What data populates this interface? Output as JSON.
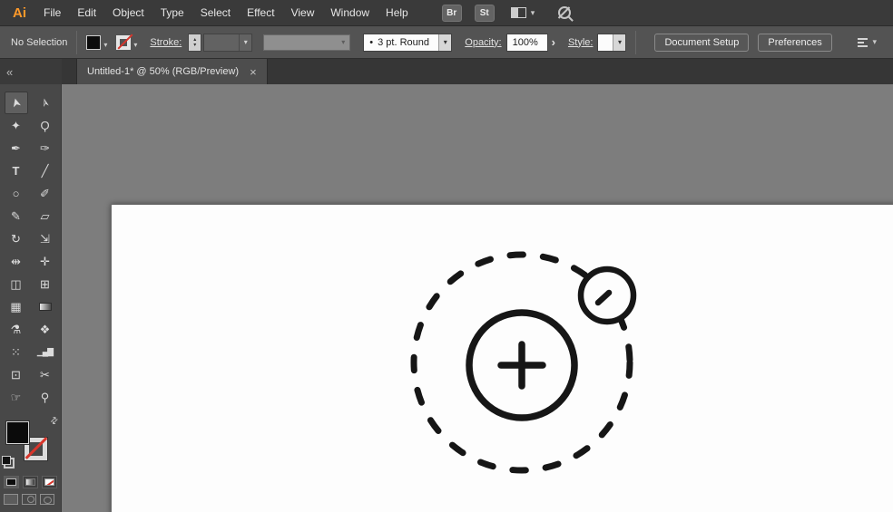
{
  "colors": {
    "accent_orange": "#ff9a2a",
    "slash_red": "#d8352b",
    "ink": "#161616",
    "canvas_bg": "#7d7d7d",
    "artboard_bg": "#fdfdfd",
    "menubar_bg": "#3a3a3a",
    "controlbar_bg": "#535353",
    "toolbar_bg": "#484848",
    "tabstrip_bg": "#363636",
    "tab_bg": "#4d4d4d"
  },
  "menubar": {
    "logo_text": "Ai",
    "menus": [
      "File",
      "Edit",
      "Object",
      "Type",
      "Select",
      "Effect",
      "View",
      "Window",
      "Help"
    ],
    "bridge_button": "Br",
    "stock_button": "St"
  },
  "controlbar": {
    "no_selection": "No Selection",
    "stroke_label": "Stroke:",
    "brush_name": "3 pt. Round",
    "opacity_label": "Opacity:",
    "opacity_value": "100%",
    "style_label": "Style:",
    "document_setup_button": "Document Setup",
    "preferences_button": "Preferences"
  },
  "tabbar": {
    "title": "Untitled-1* @ 50% (RGB/Preview)"
  },
  "toolbar": {
    "tools": [
      {
        "name": "selection",
        "glyph": "➤",
        "active": true
      },
      {
        "name": "direct-selection",
        "glyph": "➢",
        "active": false
      },
      {
        "name": "magic-wand",
        "glyph": "✦",
        "active": false
      },
      {
        "name": "lasso",
        "glyph": "Ϙ",
        "active": false
      },
      {
        "name": "pen",
        "glyph": "✒",
        "active": false
      },
      {
        "name": "curvature",
        "glyph": "✑",
        "active": false
      },
      {
        "name": "type",
        "glyph": "T",
        "active": false
      },
      {
        "name": "line-segment",
        "glyph": "╱",
        "active": false
      },
      {
        "name": "ellipse",
        "glyph": "○",
        "active": false
      },
      {
        "name": "paintbrush",
        "glyph": "✐",
        "active": false
      },
      {
        "name": "pencil",
        "glyph": "✎",
        "active": false
      },
      {
        "name": "eraser",
        "glyph": "▱",
        "active": false
      },
      {
        "name": "rotate",
        "glyph": "↻",
        "active": false
      },
      {
        "name": "scale",
        "glyph": "⇲",
        "active": false
      },
      {
        "name": "width",
        "glyph": "⇹",
        "active": false
      },
      {
        "name": "free-transform",
        "glyph": "✛",
        "active": false
      },
      {
        "name": "shape-builder",
        "glyph": "◫",
        "active": false
      },
      {
        "name": "perspective-grid",
        "glyph": "⊞",
        "active": false
      },
      {
        "name": "mesh",
        "glyph": "▦",
        "active": false
      },
      {
        "name": "gradient",
        "glyph": "■",
        "active": false
      },
      {
        "name": "eyedropper",
        "glyph": "⚗",
        "active": false
      },
      {
        "name": "blend",
        "glyph": "❖",
        "active": false
      },
      {
        "name": "symbol-sprayer",
        "glyph": "⁙",
        "active": false
      },
      {
        "name": "column-graph",
        "glyph": "▁▄▇",
        "active": false
      },
      {
        "name": "artboard",
        "glyph": "⊡",
        "active": false
      },
      {
        "name": "slice",
        "glyph": "✂",
        "active": false
      },
      {
        "name": "hand",
        "glyph": "☞",
        "active": false
      },
      {
        "name": "zoom",
        "glyph": "⚲",
        "active": false
      }
    ]
  },
  "icons": {
    "collapse": "«",
    "caret_down": "▾",
    "stepper_up": "▴",
    "stepper_down": "▾",
    "chevron_right": "›",
    "close": "×",
    "swap_arrows": "⇄",
    "brush_bullet": "•"
  }
}
